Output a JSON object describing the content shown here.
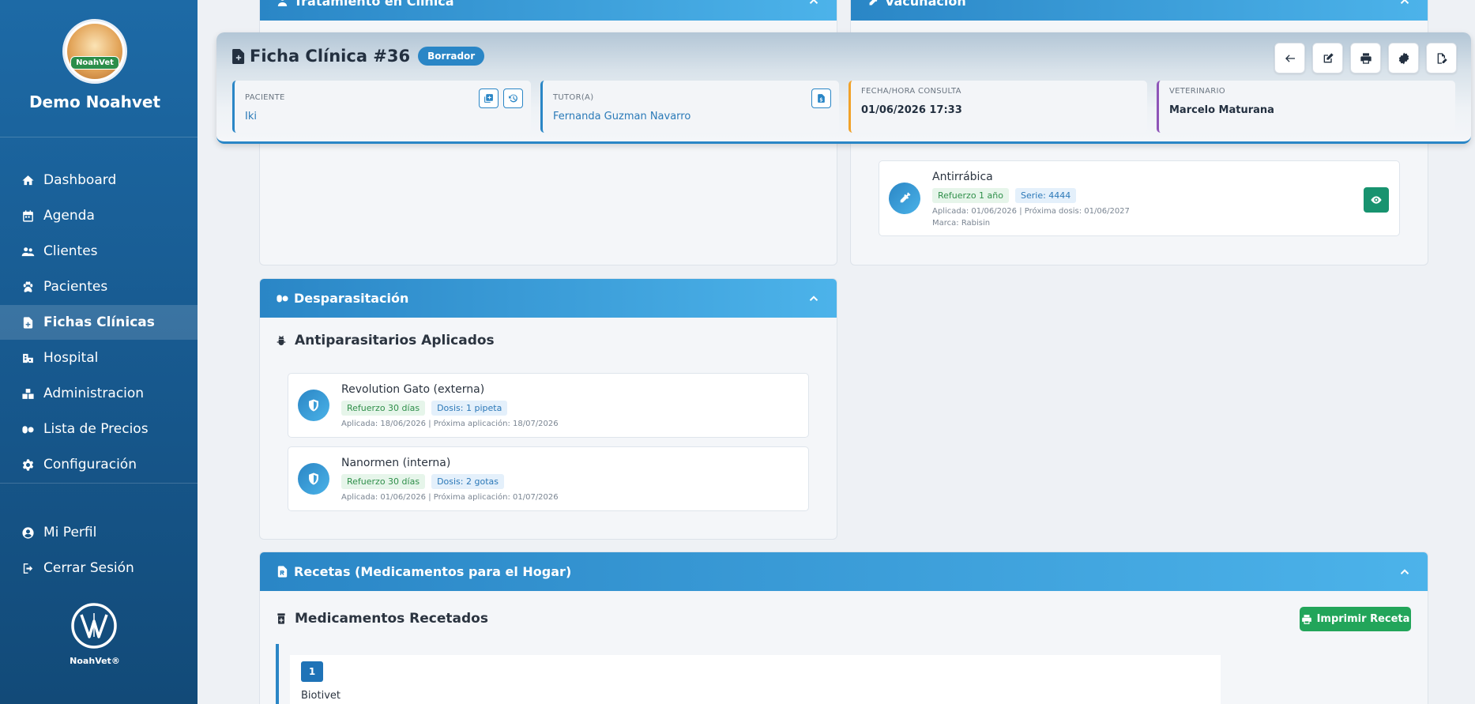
{
  "sidebar": {
    "brand": "Demo Noahvet",
    "logo_badge": "NoahVet",
    "items": [
      {
        "label": "Dashboard",
        "icon": "home-icon"
      },
      {
        "label": "Agenda",
        "icon": "calendar-icon"
      },
      {
        "label": "Clientes",
        "icon": "users-icon"
      },
      {
        "label": "Pacientes",
        "icon": "paw-icon"
      },
      {
        "label": "Fichas Clínicas",
        "icon": "file-medical-icon",
        "active": true
      },
      {
        "label": "Hospital",
        "icon": "hospital-icon"
      },
      {
        "label": "Administracion",
        "icon": "boxes-icon"
      },
      {
        "label": "Lista de Precios",
        "icon": "pills-icon"
      },
      {
        "label": "Configuración",
        "icon": "gear-icon"
      }
    ],
    "bottom_items": [
      {
        "label": "Mi Perfil",
        "icon": "user-circle-icon"
      },
      {
        "label": "Cerrar Sesión",
        "icon": "logout-icon"
      }
    ],
    "footer_brand": "NoahVet®"
  },
  "header": {
    "title": "Ficha Clínica #36",
    "status_badge": "Borrador",
    "patient_label": "PACIENTE",
    "patient": "Iki",
    "tutor_label": "TUTOR(A)",
    "tutor": "Fernanda Guzman Navarro",
    "datetime_label": "FECHA/HORA CONSULTA",
    "datetime": "01/06/2026 17:33",
    "vet_label": "VETERINARIO",
    "vet": "Marcelo Maturana"
  },
  "panels": {
    "treatment_title": "Tratamiento en Clínica",
    "vaccination_title": "Vacunación",
    "deworming_title": "Desparasitación",
    "deworming_sub": "Antiparasitarios Aplicados",
    "prescriptions_title": "Recetas (Medicamentos para el Hogar)",
    "prescriptions_sub": "Medicamentos Recetados",
    "print_button": "Imprimir Receta"
  },
  "vaccine": {
    "name": "Antirrábica",
    "tag1": "Refuerzo 1 año",
    "tag2": "Serie: 4444",
    "meta1": "Aplicada: 01/06/2026 | Próxima dosis: 01/06/2027",
    "meta2": "Marca: Rabisin"
  },
  "antiparasitics": [
    {
      "name": "Revolution Gato (externa)",
      "tag1": "Refuerzo 30 días",
      "tag2": "Dosis: 1 pipeta",
      "meta": "Aplicada: 18/06/2026 | Próxima aplicación: 18/07/2026"
    },
    {
      "name": "Nanormen (interna)",
      "tag1": "Refuerzo 30 días",
      "tag2": "Dosis: 2 gotas",
      "meta": "Aplicada: 01/06/2026 | Próxima aplicación: 01/07/2026"
    }
  ],
  "prescriptions": [
    {
      "number": "1",
      "name": "Biotivet"
    }
  ]
}
